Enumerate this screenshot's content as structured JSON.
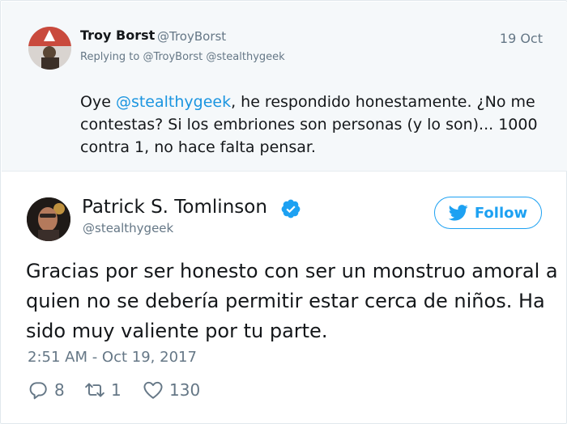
{
  "reply_tweet": {
    "name": "Troy Borst",
    "handle": "@TroyBorst",
    "date": "19 Oct",
    "replying_prefix": "Replying to",
    "replying_to_1": "@TroyBorst",
    "replying_to_2": "@stealthygeek",
    "text_part1": "Oye",
    "text_mention": "@stealthygeek",
    "text_part2": ", he respondido honestamente. ¿No me contestas? Si los embriones son personas (y lo son)... 1000 contra 1, no hace falta pensar."
  },
  "main_tweet": {
    "name": "Patrick S. Tomlinson",
    "handle": "@stealthygeek",
    "follow_label": "Follow",
    "text": "Gracias por ser honesto con ser un monstruo amoral a quien no se debería permitir estar cerca de niños. Ha sido muy valiente por tu parte.",
    "timestamp": "2:51 AM - Oct 19, 2017",
    "reply_count": "8",
    "retweet_count": "1",
    "like_count": "130"
  },
  "colors": {
    "twitter_blue": "#1da1f2",
    "link_blue": "#1b95e0",
    "muted_gray": "#657786",
    "reply_background": "#f5f8fa"
  },
  "icons": [
    "verified-badge-icon",
    "twitter-bird-icon",
    "reply-icon",
    "retweet-icon",
    "heart-icon"
  ]
}
